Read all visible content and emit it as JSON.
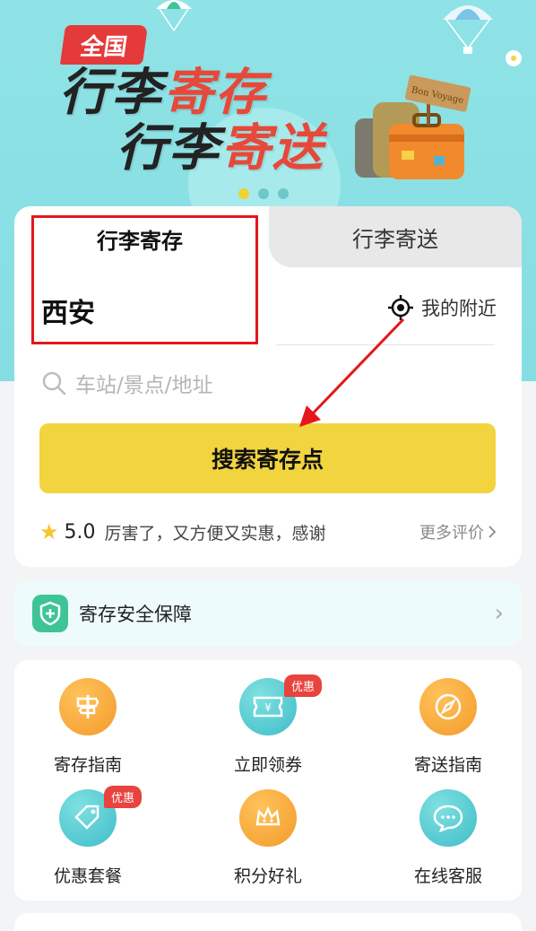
{
  "hero": {
    "badge": "全国",
    "line1_a": "行李",
    "line1_b": "寄存",
    "line2_a": "行李",
    "line2_b": "寄送",
    "sign_text": "Bon Voyage",
    "carousel_total": 3,
    "carousel_active": 1
  },
  "tabs": {
    "storage": "行李寄存",
    "delivery": "行李寄送"
  },
  "location": {
    "city": "西安",
    "nearby_label": "我的附近",
    "nearby_icon": "crosshair-icon"
  },
  "search": {
    "placeholder": "车站/景点/地址",
    "button_label": "搜索寄存点"
  },
  "review": {
    "rating": "5.0",
    "text": "厉害了，又方便又实惠，感谢",
    "more": "更多评价"
  },
  "safety": {
    "label": "寄存安全保障"
  },
  "services": [
    {
      "label": "寄存指南",
      "icon": "signpost-icon",
      "tag": ""
    },
    {
      "label": "立即领券",
      "icon": "coupon-icon",
      "tag": "优惠"
    },
    {
      "label": "寄送指南",
      "icon": "compass-icon",
      "tag": ""
    },
    {
      "label": "优惠套餐",
      "icon": "price-tag-icon",
      "tag": "优惠"
    },
    {
      "label": "积分好礼",
      "icon": "crown-icon",
      "tag": ""
    },
    {
      "label": "在线客服",
      "icon": "chat-bubble-icon",
      "tag": ""
    }
  ],
  "colors": {
    "hero_bg": "#8fe3e6",
    "accent_yellow": "#f2d43f",
    "brand_red": "#e6493a",
    "highlight_red": "#e5161c",
    "shield_green": "#3ec497"
  }
}
